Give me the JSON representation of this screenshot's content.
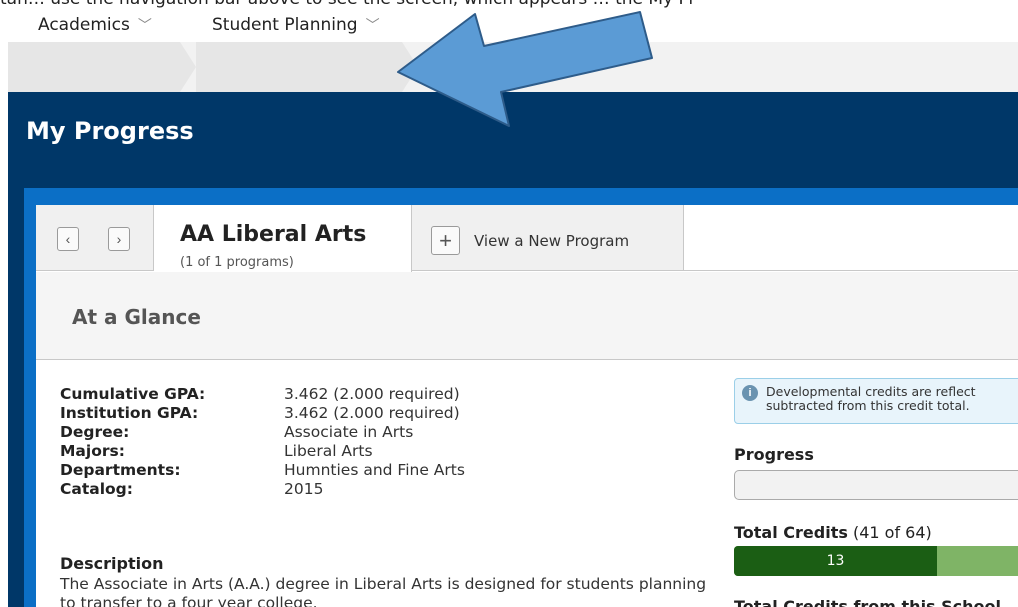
{
  "caption": "tan… use the navigation bar above to see the screen, which appears … the My Pr",
  "breadcrumb": {
    "items": [
      {
        "label": "Academics"
      },
      {
        "label": "Student Planning"
      }
    ]
  },
  "page": {
    "title": "My Progress"
  },
  "program_tabs": {
    "prev_symbol": "‹",
    "next_symbol": "›",
    "active_name": "AA Liberal Arts",
    "active_count": "(1 of 1 programs)",
    "new_program_label": "View a New Program",
    "new_program_symbol": "+"
  },
  "glance": {
    "title": "At a Glance"
  },
  "details": [
    {
      "label": "Cumulative GPA:",
      "value": "3.462 (2.000 required)"
    },
    {
      "label": "Institution GPA:",
      "value": "3.462 (2.000 required)"
    },
    {
      "label": "Degree:",
      "value": "Associate in Arts"
    },
    {
      "label": "Majors:",
      "value": "Liberal Arts"
    },
    {
      "label": "Departments:",
      "value": "Humnties and Fine Arts"
    },
    {
      "label": "Catalog:",
      "value": "2015"
    }
  ],
  "description": {
    "heading": "Description",
    "text": "The Associate in Arts (A.A.) degree in Liberal Arts is designed for students planning to transfer to a four year college."
  },
  "info_notice": {
    "line1": "Developmental credits are reflect",
    "line2": "subtracted from this credit total."
  },
  "progress": {
    "label": "Progress"
  },
  "total_credits": {
    "label": "Total Credits",
    "count": "(41 of 64)",
    "completed_value": "13",
    "completed_fraction": 0.203
  },
  "next_section_label": "Total Credits from this School",
  "colors": {
    "navy": "#003768",
    "frame_blue": "#0b6fc6",
    "arrow_fill": "#5b9bd5",
    "arrow_stroke": "#2e5c8a",
    "credits_dark": "#1b5e14",
    "credits_light": "#7fb466"
  }
}
